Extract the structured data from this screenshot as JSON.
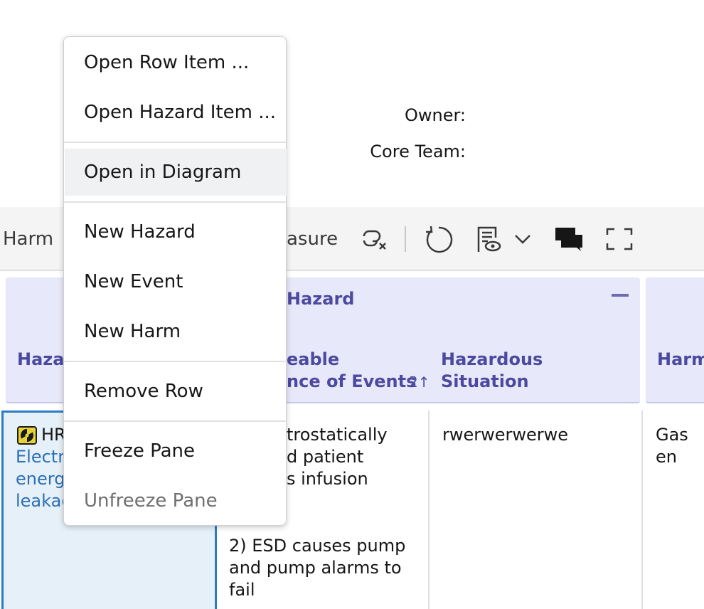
{
  "header": {
    "owner_label": "Owner:",
    "core_team_label": "Core Team:"
  },
  "toolbar": {
    "harm_label": "Harm",
    "measure_label_partial": "asure",
    "icons": [
      "unlink-icon",
      "refresh-icon",
      "report-view-icon",
      "chevron-down-icon",
      "comments-icon",
      "fullscreen-icon"
    ]
  },
  "table": {
    "group_hazard_title": "Hazard",
    "col_hazard_partial": "Hazar",
    "col_events_line1": "eable",
    "col_events_line2": "nce of Events",
    "sort_indicator": "2↑",
    "col_situation_line1": "Hazardous",
    "col_situation_line2": "Situation",
    "col_harm_partial": "Harm",
    "row1": {
      "hazard_id_partial": "HR",
      "hazard_link_line1": "Electr",
      "hazard_link_line2": "energ",
      "hazard_link_line3": "leakag",
      "events_line1": "trostatically",
      "events_line2": "d patient",
      "events_line3": "s infusion",
      "events_line4": "2) ESD causes pump",
      "events_line5": "and pump alarms to",
      "events_line6": "fail",
      "situation": "rwerwerwerwe",
      "harm_partial": "Gas en"
    }
  },
  "context_menu": {
    "items": [
      {
        "label": "Open Row Item ...",
        "state": "normal"
      },
      {
        "label": "Open Hazard Item ...",
        "state": "normal"
      },
      {
        "label": "Open in Diagram",
        "state": "hover"
      },
      {
        "label": "New Hazard",
        "state": "normal"
      },
      {
        "label": "New Event",
        "state": "normal"
      },
      {
        "label": "New Harm",
        "state": "normal"
      },
      {
        "label": "Remove Row",
        "state": "normal"
      },
      {
        "label": "Freeze Pane",
        "state": "normal"
      },
      {
        "label": "Unfreeze Pane",
        "state": "disabled"
      }
    ]
  },
  "colors": {
    "accent": "#4c4a9e",
    "link": "#2c6fb5",
    "selected_cell": "#e5f0f8",
    "group_header_bg": "#e8e8fb"
  }
}
